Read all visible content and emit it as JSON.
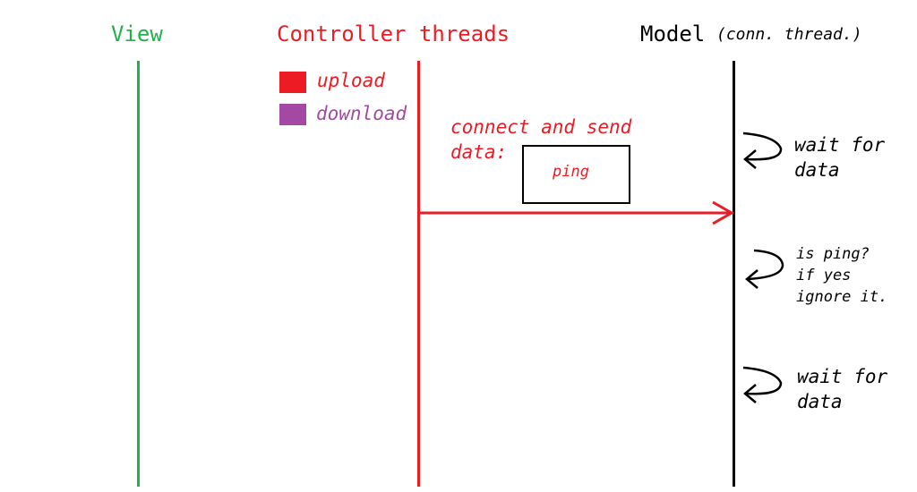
{
  "colors": {
    "view": "#22b14c",
    "controller": "#ed1c24",
    "model": "#000000",
    "upload": "#ed1c24",
    "download": "#a349a4"
  },
  "lanes": {
    "view": {
      "title": "View"
    },
    "controller": {
      "title": "Controller threads"
    },
    "model": {
      "title": "Model",
      "subtitle": "(conn. thread.)"
    }
  },
  "legend": [
    {
      "label": "upload",
      "color": "#ed1c24"
    },
    {
      "label": "download",
      "color": "#a349a4"
    }
  ],
  "message": {
    "caption_line1": "connect and send",
    "caption_line2": "data:",
    "payload": "ping"
  },
  "model_notes": [
    {
      "line1": "wait for",
      "line2": "data",
      "line3": ""
    },
    {
      "line1": "is ping?",
      "line2": "if yes",
      "line3": "ignore it."
    },
    {
      "line1": "wait for",
      "line2": "data",
      "line3": ""
    }
  ],
  "icons": {
    "self_loop": "curved-return-arrow-icon",
    "message_arrow": "arrow-right-icon"
  }
}
